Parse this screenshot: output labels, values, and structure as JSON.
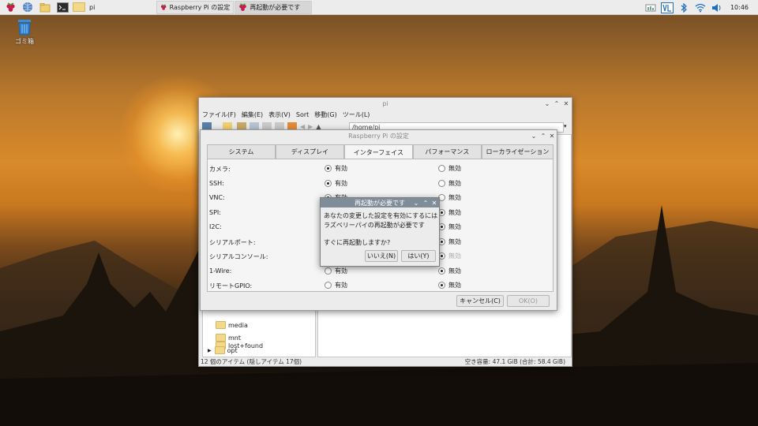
{
  "taskbar": {
    "launchers": [
      "raspberry-menu",
      "web-browser",
      "file-manager",
      "terminal"
    ],
    "folder_label": "pi",
    "tasks": [
      {
        "label": "Raspberry Pi の設定"
      },
      {
        "label": "再起動が必要です"
      }
    ],
    "clock": "10:46",
    "tray": [
      "cpu-monitor",
      "vnc-server",
      "bluetooth",
      "wifi",
      "volume"
    ]
  },
  "desktop": {
    "trash_label": "ゴミ箱"
  },
  "file_manager": {
    "title": "pi",
    "menu": [
      "ファイル(F)",
      "編集(E)",
      "表示(V)",
      "Sort",
      "移動(G)",
      "ツール(L)"
    ],
    "address": "/home/pi",
    "folders": [
      {
        "name": "lost+found"
      },
      {
        "name": "media"
      },
      {
        "name": "mnt"
      },
      {
        "name": "opt"
      }
    ],
    "status_left": "12 個のアイテム (隠しアイテム 17個)",
    "status_right": "空き容量: 47.1 GiB (合計: 58.4 GiB)"
  },
  "config": {
    "title": "Raspberry Pi の設定",
    "tabs": [
      "システム",
      "ディスプレイ",
      "インターフェイス",
      "パフォーマンス",
      "ローカライゼーション"
    ],
    "active_tab": "インターフェイス",
    "enabled_label": "有効",
    "disabled_label": "無効",
    "rows": [
      {
        "label": "カメラ:",
        "enabled": true
      },
      {
        "label": "SSH:",
        "enabled": true
      },
      {
        "label": "VNC:",
        "enabled": true
      },
      {
        "label": "SPI:",
        "enabled": false
      },
      {
        "label": "I2C:",
        "enabled": false
      },
      {
        "label": "シリアルポート:",
        "enabled": false
      },
      {
        "label": "シリアルコンソール:",
        "enabled": false
      },
      {
        "label": "1-Wire:",
        "enabled": false
      },
      {
        "label": "リモートGPIO:",
        "enabled": false
      }
    ],
    "cancel_label": "キャンセル(C)",
    "ok_label": "OK(O)"
  },
  "dialog": {
    "title": "再起動が必要です",
    "message_line1": "あなたの変更した設定を有効にするには",
    "message_line2": "ラズベリーパイの再起動が必要です",
    "question": "すぐに再起動しますか?",
    "no_label": "いいえ(N)",
    "yes_label": "はい(Y)"
  }
}
